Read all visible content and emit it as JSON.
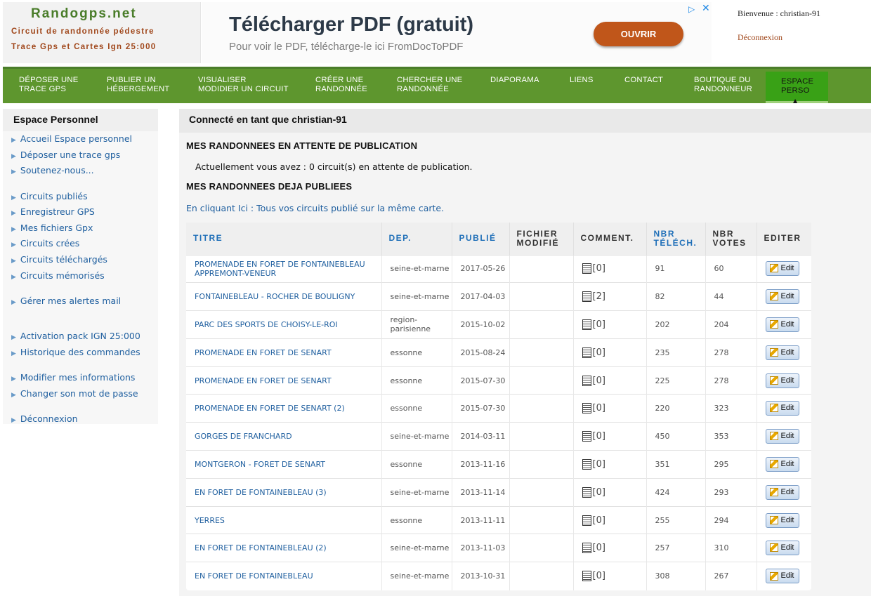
{
  "logo": {
    "title": "Randogps.net",
    "line1": "Circuit de randonnée pédestre",
    "line2": "Trace Gps et Cartes Ign 25:000"
  },
  "ad": {
    "title": "Télécharger PDF (gratuit)",
    "subtitle": "Pour voir le PDF, télécharge-le ici FromDocToPDF",
    "button": "OUVRIR",
    "choices_icon": "adchoices-icon",
    "close_glyph": "✕"
  },
  "user": {
    "welcome": "Bienvenue : christian-91",
    "logout": "Déconnexion"
  },
  "nav": [
    {
      "line1": "Déposer une",
      "line2": "trace GPS"
    },
    {
      "line1": "Publier un",
      "line2": "hébergement"
    },
    {
      "line1": "Visualiser",
      "line2": "Modidier un circuit"
    },
    {
      "line1": "Créer une",
      "line2": "randonnée"
    },
    {
      "line1": "Chercher une",
      "line2": "randonnée"
    },
    {
      "line1": "Diaporama",
      "line2": ""
    },
    {
      "line1": "Liens",
      "line2": ""
    },
    {
      "line1": "Contact",
      "line2": ""
    },
    {
      "line1": "Boutique du",
      "line2": "randonneur"
    },
    {
      "line1": "Espace",
      "line2": "Perso"
    }
  ],
  "sidebar": {
    "title": "Espace Personnel",
    "items": [
      "Accueil Espace personnel",
      "Déposer une trace gps",
      "Soutenez-nous...",
      "Circuits publiés",
      "Enregistreur GPS",
      "Mes fichiers Gpx",
      "Circuits crées",
      "Circuits téléchargés",
      "Circuits mémorisés",
      "Gérer mes alertes mail",
      "Activation pack IGN 25:000",
      "Historique des commandes",
      "Modifier mes informations",
      "Changer son mot de passe",
      "Déconnexion"
    ]
  },
  "main": {
    "title": "Connecté en tant que christian-91",
    "pending_title": "MES RANDONNEES EN ATTENTE DE PUBLICATION",
    "pending_text": "Actuellement vous avez : 0 circuit(s) en attente de publication.",
    "published_title": "MES RANDONNEES DEJA PUBLIEES",
    "map_link": "En cliquant Ici : Tous vos circuits publié sur la même carte."
  },
  "table": {
    "headers": [
      {
        "l1": "TITRE",
        "l2": ""
      },
      {
        "l1": "DEP.",
        "l2": ""
      },
      {
        "l1": "PUBLIÉ",
        "l2": ""
      },
      {
        "l1": "FICHIER",
        "l2": "MODIFIÉ"
      },
      {
        "l1": "COMMENT.",
        "l2": ""
      },
      {
        "l1": "NBR",
        "l2": "TÉLÉCH."
      },
      {
        "l1": "NBR",
        "l2": "VOTES"
      },
      {
        "l1": "EDITER",
        "l2": ""
      }
    ],
    "edit_label": "Edit",
    "rows": [
      {
        "title": "PROMENADE EN FORET DE FONTAINEBLEAU APPREMONT-VENEUR",
        "dep": "seine-et-marne",
        "date": "2017-05-26",
        "comments": "[0]",
        "downloads": "91",
        "votes": "60"
      },
      {
        "title": "FONTAINEBLEAU - ROCHER DE BOULIGNY",
        "dep": "seine-et-marne",
        "date": "2017-04-03",
        "comments": "[2]",
        "downloads": "82",
        "votes": "44"
      },
      {
        "title": "PARC DES SPORTS DE CHOISY-LE-ROI",
        "dep": "region-parisienne",
        "date": "2015-10-02",
        "comments": "[0]",
        "downloads": "202",
        "votes": "204"
      },
      {
        "title": "PROMENADE EN FORET DE SENART",
        "dep": "essonne",
        "date": "2015-08-24",
        "comments": "[0]",
        "downloads": "235",
        "votes": "278"
      },
      {
        "title": "PROMENADE EN FORET DE SENART",
        "dep": "essonne",
        "date": "2015-07-30",
        "comments": "[0]",
        "downloads": "225",
        "votes": "278"
      },
      {
        "title": "PROMENADE EN FORET DE SENART (2)",
        "dep": "essonne",
        "date": "2015-07-30",
        "comments": "[0]",
        "downloads": "220",
        "votes": "323"
      },
      {
        "title": "GORGES DE FRANCHARD",
        "dep": "seine-et-marne",
        "date": "2014-03-11",
        "comments": "[0]",
        "downloads": "450",
        "votes": "353"
      },
      {
        "title": "MONTGERON - FORET DE SENART",
        "dep": "essonne",
        "date": "2013-11-16",
        "comments": "[0]",
        "downloads": "351",
        "votes": "295"
      },
      {
        "title": "EN FORET DE FONTAINEBLEAU (3)",
        "dep": "seine-et-marne",
        "date": "2013-11-14",
        "comments": "[0]",
        "downloads": "424",
        "votes": "293"
      },
      {
        "title": "YERRES",
        "dep": "essonne",
        "date": "2013-11-11",
        "comments": "[0]",
        "downloads": "255",
        "votes": "294"
      },
      {
        "title": "EN FORET DE FONTAINEBLEAU (2)",
        "dep": "seine-et-marne",
        "date": "2013-11-03",
        "comments": "[0]",
        "downloads": "257",
        "votes": "310"
      },
      {
        "title": "EN FORET DE FONTAINEBLEAU",
        "dep": "seine-et-marne",
        "date": "2013-10-31",
        "comments": "[0]",
        "downloads": "308",
        "votes": "267"
      }
    ]
  }
}
